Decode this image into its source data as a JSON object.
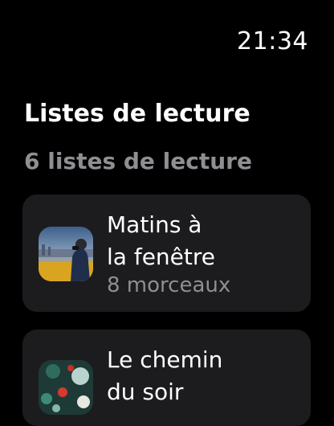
{
  "status": {
    "time": "21:34"
  },
  "header": {
    "title": "Listes de lecture",
    "count_label": "6 listes de lecture"
  },
  "playlists": [
    {
      "title_lines": [
        "Matins à",
        "la fenêtre"
      ],
      "subtitle": "8 morceaux"
    },
    {
      "title_lines": [
        "Le chemin",
        "du soir"
      ]
    }
  ],
  "colors": {
    "background": "#000000",
    "card": "#1c1c1e",
    "secondary_text": "#8e8e93"
  }
}
